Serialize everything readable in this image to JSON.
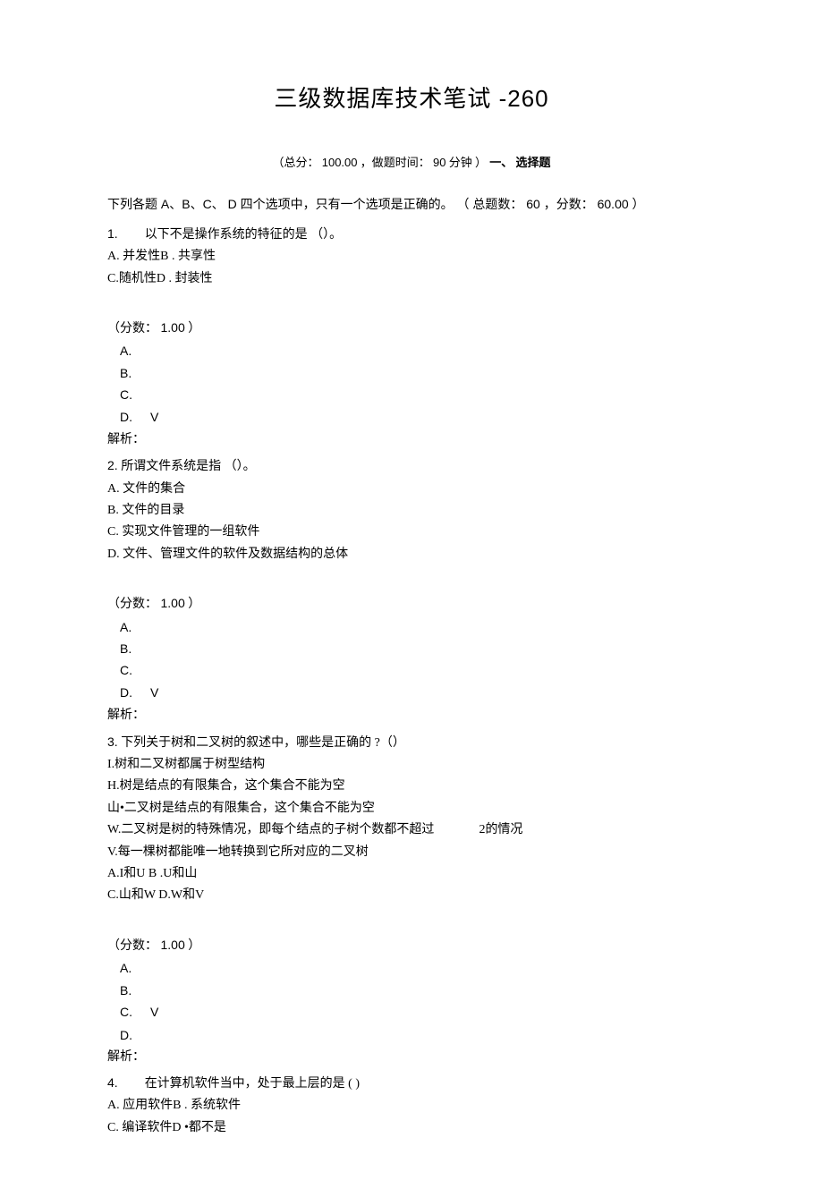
{
  "title_main": "三级数据库技术笔试",
  "title_suffix": "-260",
  "meta_prefix": "（总分：",
  "meta_total": "100.00",
  "meta_mid1": "，做题时间：",
  "meta_time": "90",
  "meta_mid2": " 分钟 ）",
  "meta_section_num": "一、",
  "meta_section_label": "选择题",
  "instruction_prefix": "下列各题 A、B、C、 D 四个选项中，只有一个选项是正确的。",
  "instruction_count_label": "（ 总题数：",
  "instruction_count": "60",
  "instruction_score_label": "，分数：",
  "instruction_score": "60.00",
  "instruction_close": "）",
  "score_label": "（分数：",
  "score_value": "1.00",
  "score_close": "）",
  "opt_A": "A.",
  "opt_B": "B.",
  "opt_C": "C.",
  "opt_D": "D.",
  "check": "V",
  "analysis": "解析：",
  "q1": {
    "num": "1.",
    "stem": "以下不是操作系统的特征的是 （）。",
    "lineA": "A.     并发性B . 共享性",
    "lineC": "C.随机性D . 封装性",
    "answer": "D"
  },
  "q2": {
    "num": "2.",
    "stem": "所谓文件系统是指 （）。",
    "a": "A.  文件的集合",
    "b": "B.  文件的目录",
    "c": "C.  实现文件管理的一组软件",
    "d": "D.  文件、管理文件的软件及数据结构的总体",
    "answer": "D"
  },
  "q3": {
    "num": "3.",
    "stem": "下列关于树和二叉树的叙述中，哪些是正确的 ?（）",
    "s1": "I.树和二叉树都属于树型结构",
    "s2": "H.树是结点的有限集合，这个集合不能为空",
    "s3": "山•二叉树是结点的有限集合，这个集合不能为空",
    "s4a": "W.二叉树是树的特殊情况，即每个结点的子树个数都不超过",
    "s4b": "2的情况",
    "s5": "V.每一棵树都能唯一地转换到它所对应的二叉树",
    "optA": "A.I和U B .U和山",
    "optC": "C.山和W D.W和V",
    "answer": "C"
  },
  "q4": {
    "num": "4.",
    "stem": "在计算机软件当中，处于最上层的是 ( )",
    "lineA": "A.      应用软件B . 系统软件",
    "lineC": "C.      编译软件D •都不是"
  }
}
